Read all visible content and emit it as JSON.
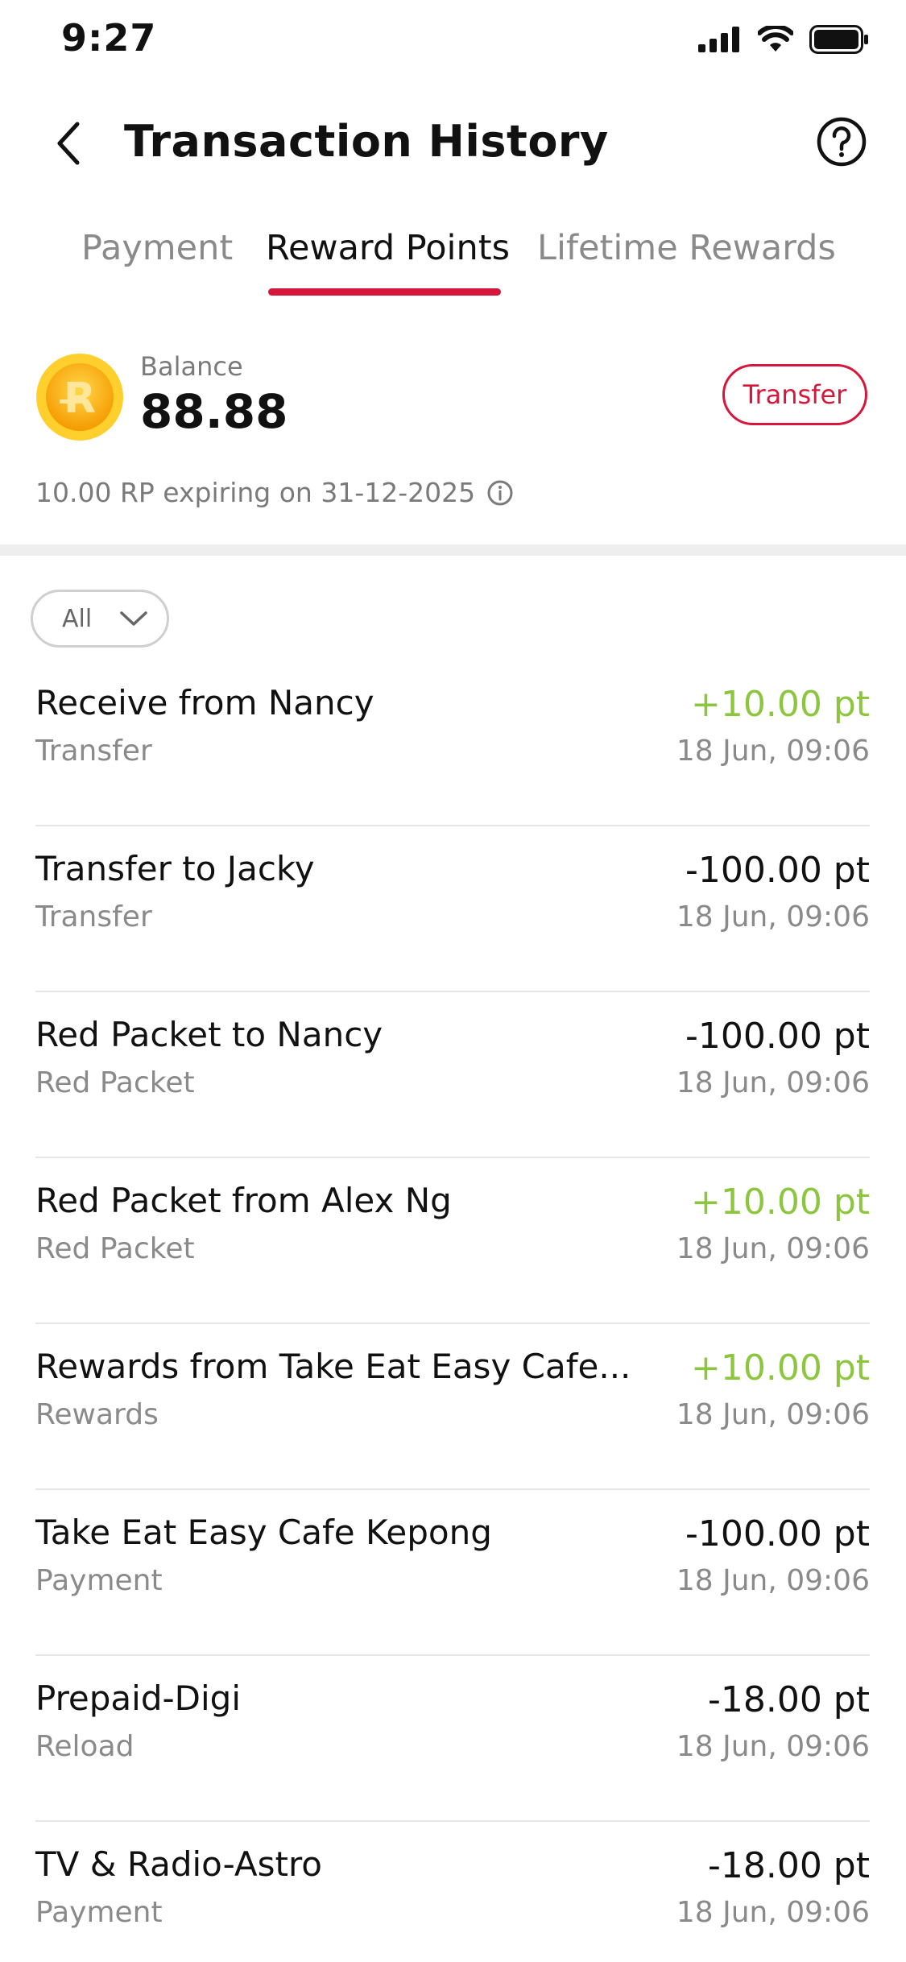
{
  "status_bar": {
    "time": "9:27"
  },
  "header": {
    "title": "Transaction History"
  },
  "tabs": [
    {
      "label": "Payment",
      "active": false
    },
    {
      "label": "Reward Points",
      "active": true
    },
    {
      "label": "Lifetime Rewards",
      "active": false
    }
  ],
  "balance": {
    "label": "Balance",
    "value": "88.88",
    "coin_letter": "R",
    "transfer_label": "Transfer",
    "expiry_text": "10.00 RP expiring on 31-12-2025"
  },
  "filter": {
    "label": "All"
  },
  "transactions": [
    {
      "title": "Receive from Nancy",
      "category": "Transfer",
      "amount": "+10.00 pt",
      "time": "18 Jun, 09:06",
      "positive": true
    },
    {
      "title": "Transfer to Jacky",
      "category": "Transfer",
      "amount": "-100.00 pt",
      "time": "18 Jun, 09:06",
      "positive": false
    },
    {
      "title": "Red Packet to Nancy",
      "category": "Red Packet",
      "amount": "-100.00 pt",
      "time": "18 Jun, 09:06",
      "positive": false
    },
    {
      "title": "Red Packet from Alex Ng",
      "category": "Red Packet",
      "amount": "+10.00 pt",
      "time": "18 Jun, 09:06",
      "positive": true
    },
    {
      "title": "Rewards from Take Eat Easy Cafe...",
      "category": "Rewards",
      "amount": "+10.00 pt",
      "time": "18 Jun, 09:06",
      "positive": true
    },
    {
      "title": "Take Eat Easy Cafe Kepong",
      "category": "Payment",
      "amount": "-100.00 pt",
      "time": "18 Jun, 09:06",
      "positive": false
    },
    {
      "title": "Prepaid-Digi",
      "category": "Reload",
      "amount": "-18.00 pt",
      "time": "18 Jun, 09:06",
      "positive": false
    },
    {
      "title": "TV & Radio-Astro",
      "category": "Payment",
      "amount": "-18.00 pt",
      "time": "18 Jun, 09:06",
      "positive": false
    }
  ],
  "colors": {
    "accent": "#d7163b",
    "positive": "#8cc63f",
    "coin": "#f9b300",
    "muted_text": "#8a8a8a"
  }
}
